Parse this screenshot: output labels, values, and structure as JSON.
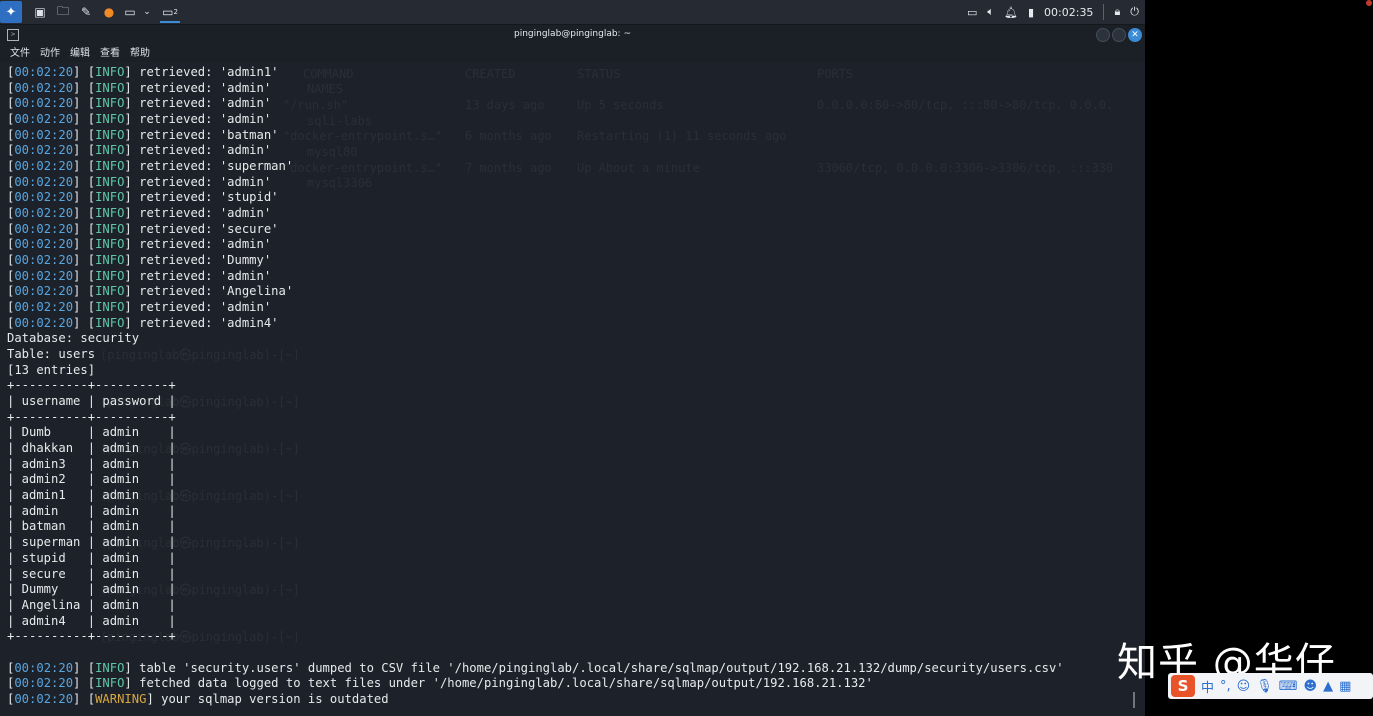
{
  "taskbar": {
    "clock": "00:02:35",
    "badge": "2"
  },
  "window": {
    "title": "pinginglab@pinginglab: ~"
  },
  "menu": [
    "文件",
    "动作",
    "编辑",
    "查看",
    "帮助"
  ],
  "ghost_text": {
    "header_cols": [
      "COMMAND",
      "CREATED",
      "STATUS",
      "PORTS"
    ],
    "header_names": "NAMES",
    "rows": [
      {
        "cmd": "\"/run.sh\"",
        "created": "13 days ago",
        "status": "Up 5 seconds",
        "ports": "0.0.0.0:80->80/tcp, :::80->80/tcp, 0.0.0."
      },
      {
        "names": "sqli-labs"
      },
      {
        "cmd": "\"docker-entrypoint.s…\"",
        "created": "6 months ago",
        "status": "Restarting (1) 11 seconds ago"
      },
      {
        "names": "mysql80"
      },
      {
        "cmd": "\"docker-entrypoint.s…\"",
        "created": "7 months ago",
        "status": "Up About a minute",
        "ports": "33060/tcp, 0.0.0.0:3306->3306/tcp, :::330"
      },
      {
        "names": "mysql3306"
      }
    ],
    "prompt": "(pinginglab㉿pinginglab)-[~]"
  },
  "terminal": {
    "lines": [
      {
        "ts": "00:02:20",
        "lvl": "INFO",
        "msg": " retrieved: 'admin1'"
      },
      {
        "ts": "00:02:20",
        "lvl": "INFO",
        "msg": " retrieved: 'admin'"
      },
      {
        "ts": "00:02:20",
        "lvl": "INFO",
        "msg": " retrieved: 'admin'"
      },
      {
        "ts": "00:02:20",
        "lvl": "INFO",
        "msg": " retrieved: 'admin'"
      },
      {
        "ts": "00:02:20",
        "lvl": "INFO",
        "msg": " retrieved: 'batman'"
      },
      {
        "ts": "00:02:20",
        "lvl": "INFO",
        "msg": " retrieved: 'admin'"
      },
      {
        "ts": "00:02:20",
        "lvl": "INFO",
        "msg": " retrieved: 'superman'"
      },
      {
        "ts": "00:02:20",
        "lvl": "INFO",
        "msg": " retrieved: 'admin'"
      },
      {
        "ts": "00:02:20",
        "lvl": "INFO",
        "msg": " retrieved: 'stupid'"
      },
      {
        "ts": "00:02:20",
        "lvl": "INFO",
        "msg": " retrieved: 'admin'"
      },
      {
        "ts": "00:02:20",
        "lvl": "INFO",
        "msg": " retrieved: 'secure'"
      },
      {
        "ts": "00:02:20",
        "lvl": "INFO",
        "msg": " retrieved: 'admin'"
      },
      {
        "ts": "00:02:20",
        "lvl": "INFO",
        "msg": " retrieved: 'Dummy'"
      },
      {
        "ts": "00:02:20",
        "lvl": "INFO",
        "msg": " retrieved: 'admin'"
      },
      {
        "ts": "00:02:20",
        "lvl": "INFO",
        "msg": " retrieved: 'Angelina'"
      },
      {
        "ts": "00:02:20",
        "lvl": "INFO",
        "msg": " retrieved: 'admin'"
      },
      {
        "ts": "00:02:20",
        "lvl": "INFO",
        "msg": " retrieved: 'admin4'"
      },
      {
        "text": "Database: security"
      },
      {
        "text": "Table: users"
      },
      {
        "text": "[13 entries]"
      },
      {
        "text": "+----------+----------+"
      },
      {
        "text": "| username | password |"
      },
      {
        "text": "+----------+----------+"
      },
      {
        "text": "| Dumb     | admin    |"
      },
      {
        "text": "| dhakkan  | admin    |"
      },
      {
        "text": "| admin3   | admin    |"
      },
      {
        "text": "| admin2   | admin    |"
      },
      {
        "text": "| admin1   | admin    |"
      },
      {
        "text": "| admin    | admin    |"
      },
      {
        "text": "| batman   | admin    |"
      },
      {
        "text": "| superman | admin    |"
      },
      {
        "text": "| stupid   | admin    |"
      },
      {
        "text": "| secure   | admin    |"
      },
      {
        "text": "| Dummy    | admin    |"
      },
      {
        "text": "| Angelina | admin    |"
      },
      {
        "text": "| admin4   | admin    |"
      },
      {
        "text": "+----------+----------+"
      },
      {
        "text": ""
      },
      {
        "ts": "00:02:20",
        "lvl": "INFO",
        "msg": " table 'security.users' dumped to CSV file '/home/pinginglab/.local/share/sqlmap/output/192.168.21.132/dump/security/users.csv'"
      },
      {
        "ts": "00:02:20",
        "lvl": "INFO",
        "msg": " fetched data logged to text files under '/home/pinginglab/.local/share/sqlmap/output/192.168.21.132'"
      },
      {
        "ts": "00:02:20",
        "lvl": "WARNING",
        "msg": " your sqlmap version is outdated"
      }
    ]
  },
  "watermark": "知乎 @华仔",
  "ime": {
    "logo": "S",
    "mode": "中",
    "punct": "°,"
  },
  "colors": {
    "timestamp": "#58a6e0",
    "info": "#5fc6a8",
    "warning": "#d9a740",
    "terminal_bg": "#1d2129"
  }
}
